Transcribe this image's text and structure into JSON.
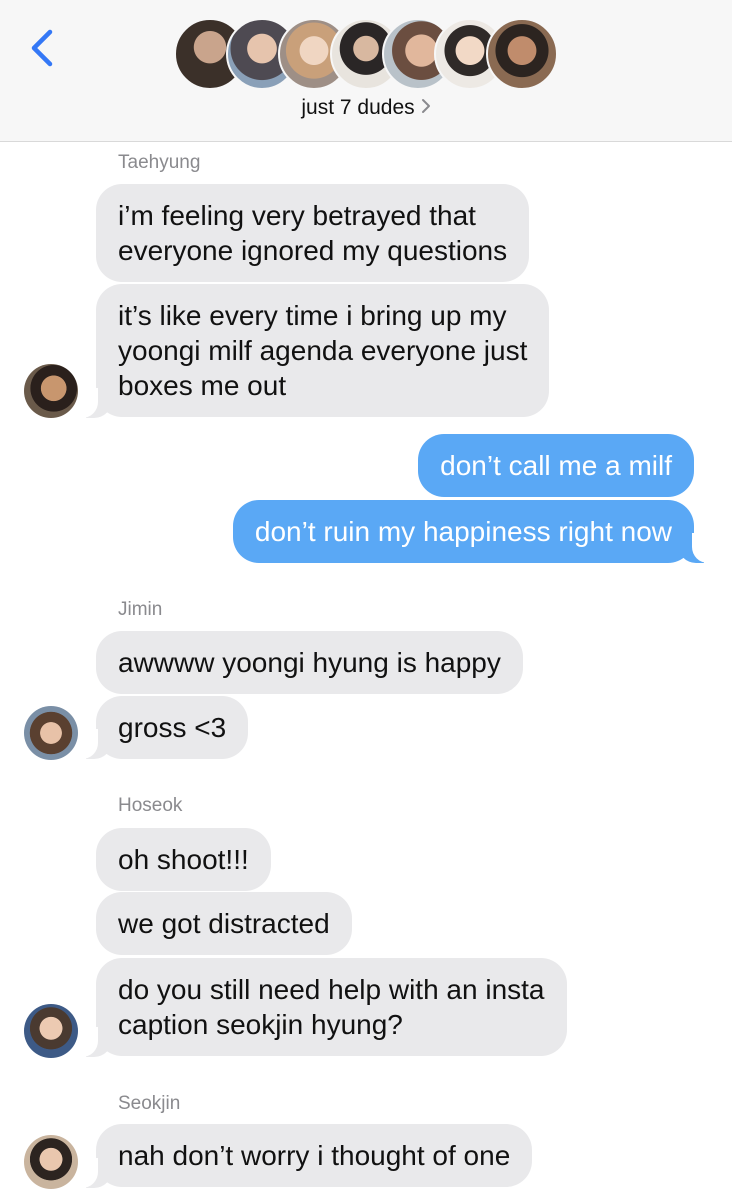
{
  "header": {
    "group_name": "just 7 dudes",
    "chevron": "chevron-right-icon",
    "back_icon": "chevron-left-icon"
  },
  "colors": {
    "accent": "#3478f6",
    "incoming_bubble": "#e9e9eb",
    "outgoing_bubble": "#5aa8f5",
    "header_bg": "#f7f7f7"
  },
  "thread": {
    "taehyung": {
      "sender": "Taehyung",
      "messages": [
        [
          "i’m feeling very betrayed that",
          "everyone ignored my questions"
        ],
        [
          "it’s like every time i bring up my",
          "yoongi milf agenda everyone just",
          "boxes me out"
        ]
      ]
    },
    "outgoing": {
      "messages": [
        "don’t call me a milf",
        "don’t ruin my happiness right now"
      ]
    },
    "jimin": {
      "sender": "Jimin",
      "messages": [
        "awwww yoongi hyung is happy",
        "gross <3"
      ]
    },
    "hoseok": {
      "sender": "Hoseok",
      "messages": [
        [
          "oh shoot!!!"
        ],
        [
          "we got distracted"
        ],
        [
          "do you still need help with an insta",
          "caption seokjin hyung?"
        ]
      ]
    },
    "seokjin": {
      "sender": "Seokjin",
      "messages": [
        "nah don’t worry i thought of one"
      ]
    }
  }
}
